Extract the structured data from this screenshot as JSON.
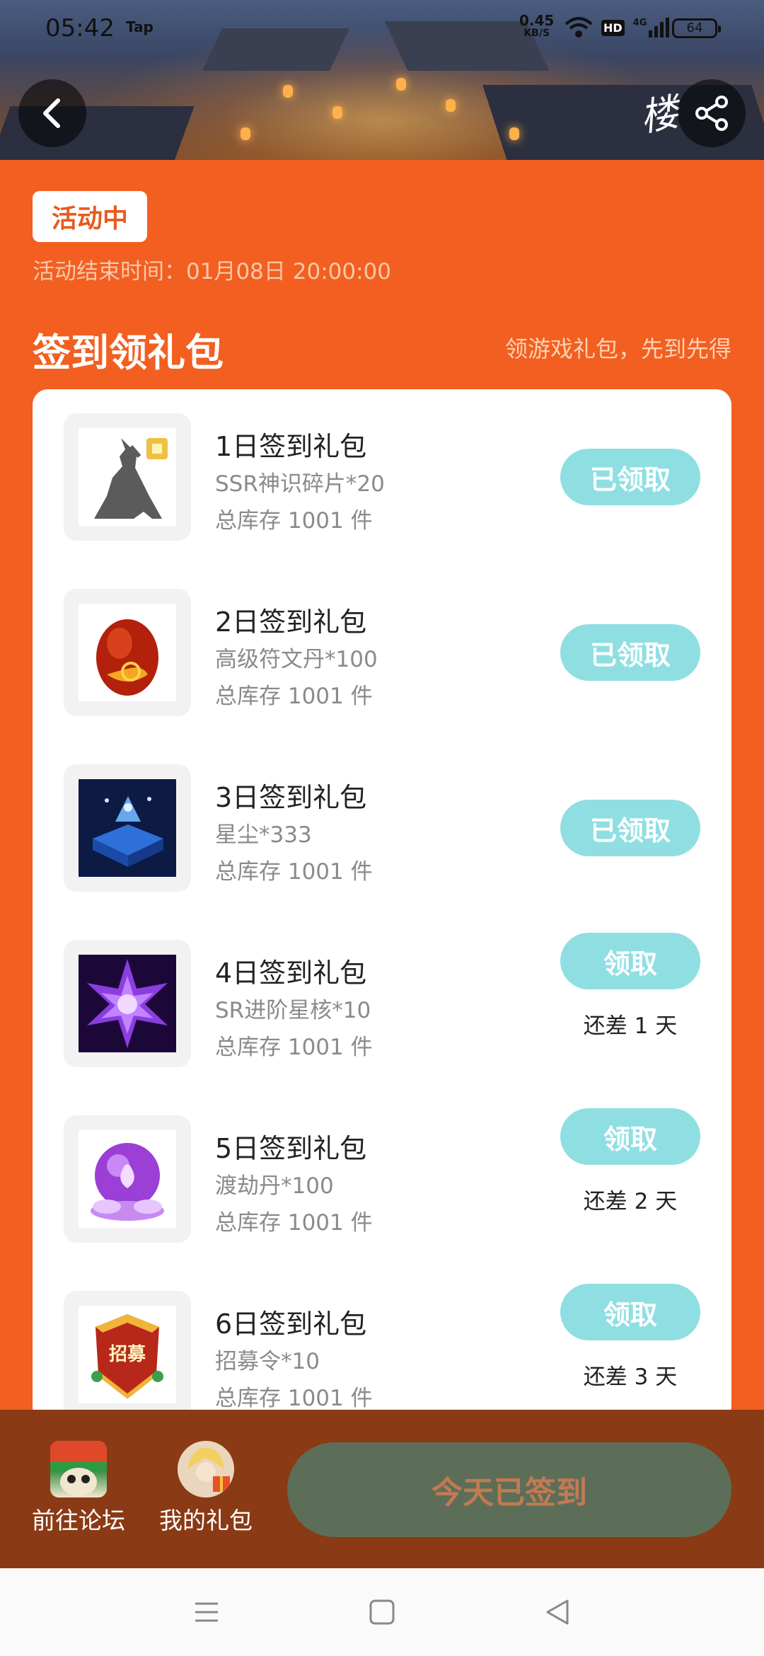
{
  "statusbar": {
    "time": "05:42",
    "tap": "Tap",
    "speed_value": "0.45",
    "speed_unit": "KB/S",
    "hd": "HD",
    "net": "4G",
    "battery": "64"
  },
  "header": {
    "calligraphy": "楼"
  },
  "activity": {
    "status_badge": "活动中",
    "end_time": "活动结束时间：01月08日 20:00:00",
    "section_title": "签到领礼包",
    "section_subtitle": "领游戏礼包，先到先得"
  },
  "gifts": [
    {
      "title": "1日签到礼包",
      "desc": "SSR神识碎片*20",
      "stock": "总库存 1001 件",
      "button": "已领取",
      "remain": ""
    },
    {
      "title": "2日签到礼包",
      "desc": "高级符文丹*100",
      "stock": "总库存 1001 件",
      "button": "已领取",
      "remain": ""
    },
    {
      "title": "3日签到礼包",
      "desc": "星尘*333",
      "stock": "总库存 1001 件",
      "button": "已领取",
      "remain": ""
    },
    {
      "title": "4日签到礼包",
      "desc": "SR进阶星核*10",
      "stock": "总库存 1001 件",
      "button": "领取",
      "remain": "还差 1 天"
    },
    {
      "title": "5日签到礼包",
      "desc": "渡劫丹*100",
      "stock": "总库存 1001 件",
      "button": "领取",
      "remain": "还差 2 天"
    },
    {
      "title": "6日签到礼包",
      "desc": "招募令*10",
      "stock": "总库存 1001 件",
      "button": "领取",
      "remain": "还差 3 天"
    }
  ],
  "thumb6_text": "招募",
  "bottom": {
    "forum_label": "前往论坛",
    "mygifts_label": "我的礼包",
    "signed_button": "今天已签到"
  },
  "colors": {
    "background": "#f25f21",
    "button": "#8fdfe2",
    "bottom_bar": "#8a3a14",
    "signed_button": "#5d6e58"
  }
}
